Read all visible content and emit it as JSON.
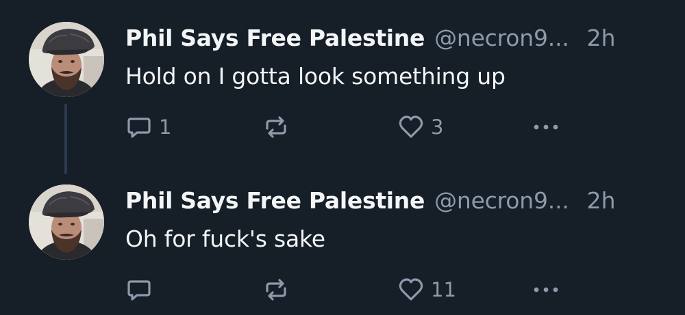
{
  "colors": {
    "background": "#161e27",
    "text_primary": "#f3f5f7",
    "text_secondary": "#8d9aab",
    "thread_line": "#2c3b4d"
  },
  "posts": [
    {
      "author": {
        "display_name": "Phil Says Free Palestine",
        "handle": "@necron9...",
        "avatar_icon": "avatar-photo"
      },
      "time": "2h",
      "text": "Hold on I gotta look something up",
      "reply_count": "1",
      "like_count": "3",
      "icons": [
        "reply-icon",
        "repost-icon",
        "like-icon",
        "more-options-icon"
      ]
    },
    {
      "author": {
        "display_name": "Phil Says Free Palestine",
        "handle": "@necron9...",
        "avatar_icon": "avatar-photo"
      },
      "time": "2h",
      "text": "Oh for fuck's sake",
      "reply_count": "",
      "like_count": "11",
      "icons": [
        "reply-icon",
        "repost-icon",
        "like-icon",
        "more-options-icon"
      ]
    }
  ]
}
